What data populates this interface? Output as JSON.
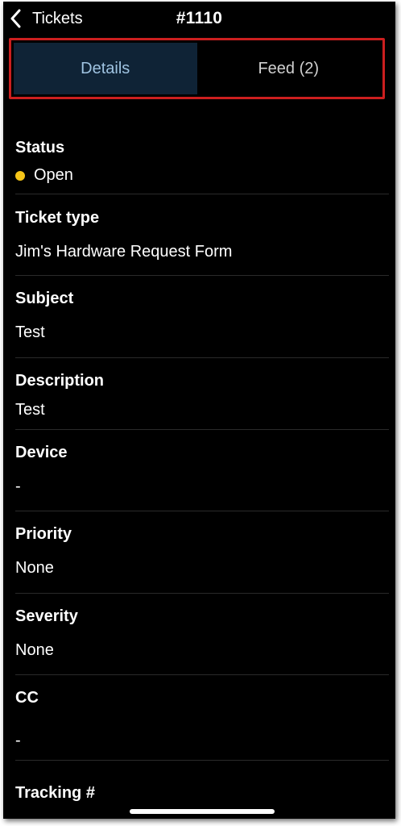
{
  "header": {
    "back_label": "Tickets",
    "ticket_number": "#1110"
  },
  "tabs": [
    {
      "label": "Details",
      "active": true
    },
    {
      "label": "Feed (2)",
      "active": false
    }
  ],
  "fields": {
    "status": {
      "label": "Status",
      "value": "Open",
      "dot_color": "#f5c518"
    },
    "ticket_type": {
      "label": "Ticket type",
      "value": "Jim's Hardware Request Form"
    },
    "subject": {
      "label": "Subject",
      "value": "Test"
    },
    "description": {
      "label": "Description",
      "value": "Test"
    },
    "device": {
      "label": "Device",
      "value": "-"
    },
    "priority": {
      "label": "Priority",
      "value": "None"
    },
    "severity": {
      "label": "Severity",
      "value": "None"
    },
    "cc": {
      "label": "CC",
      "value": "-"
    },
    "tracking": {
      "label": "Tracking #"
    }
  },
  "colors": {
    "tab_highlight_border": "#cc1f1f",
    "active_tab_bg": "#0f2336",
    "active_tab_text": "#9fc3e1"
  }
}
